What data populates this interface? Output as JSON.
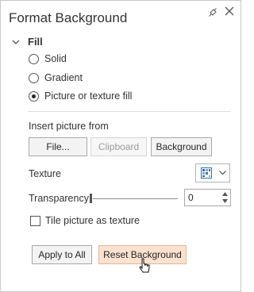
{
  "pane": {
    "title": "Format Background",
    "pin_icon": "pin-icon",
    "close_icon": "close-icon"
  },
  "fill": {
    "section_label": "Fill",
    "options": [
      {
        "label": "Solid",
        "checked": false
      },
      {
        "label": "Gradient",
        "checked": false
      },
      {
        "label": "Picture or texture fill",
        "checked": true
      }
    ]
  },
  "insert_picture": {
    "label": "Insert picture from",
    "file_button": "File...",
    "clipboard_button": "Clipboard",
    "background_button": "Background"
  },
  "texture": {
    "label": "Texture",
    "icon": "texture-swatch-icon"
  },
  "transparency": {
    "label": "Transparency",
    "value": "0"
  },
  "tile": {
    "label": "Tile picture as texture",
    "checked": false
  },
  "footer": {
    "apply_all_button": "Apply to All",
    "reset_button": "Reset Background"
  },
  "colors": {
    "accent_button_bg": "#fbe1d0",
    "accent_button_border": "#e8b596"
  }
}
